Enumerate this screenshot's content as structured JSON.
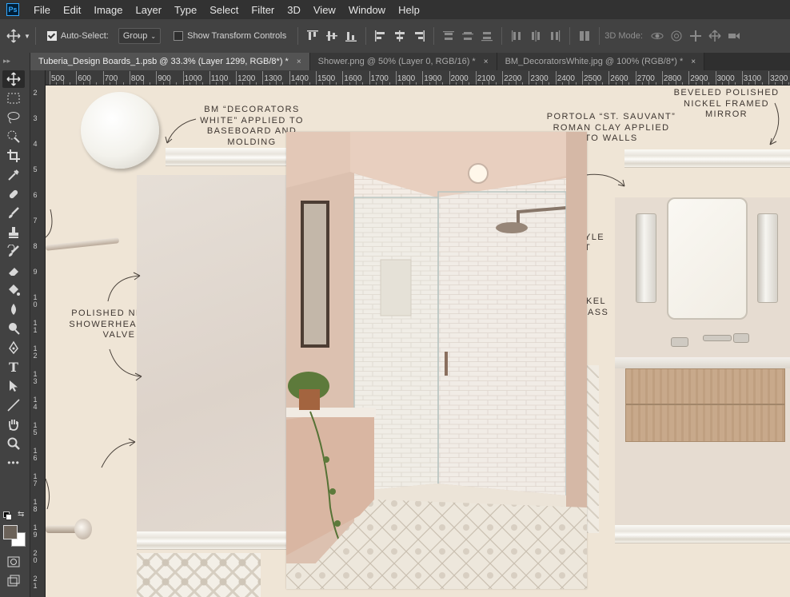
{
  "app": {
    "logo": "Ps"
  },
  "menu": [
    "File",
    "Edit",
    "Image",
    "Layer",
    "Type",
    "Select",
    "Filter",
    "3D",
    "View",
    "Window",
    "Help"
  ],
  "options": {
    "auto_select_label": "Auto-Select:",
    "auto_select_checked": true,
    "auto_select_target": "Group",
    "transform_controls_label": "Show Transform Controls",
    "mode_label": "3D Mode:"
  },
  "tabs": [
    {
      "title": "Tuberia_Design Boards_1.psb @ 33.3% (Layer 1299, RGB/8*) *",
      "active": true,
      "close": "×"
    },
    {
      "title": "Shower.png @ 50% (Layer 0, RGB/16) *",
      "active": false,
      "close": "×"
    },
    {
      "title": "BM_DecoratorsWhite.jpg @ 100% (RGB/8*) *",
      "active": false,
      "close": "×"
    }
  ],
  "ruler_h": [
    "500",
    "600",
    "700",
    "800",
    "900",
    "1000",
    "1100",
    "1200",
    "1300",
    "1400",
    "1500",
    "1600",
    "1700",
    "1800",
    "1900",
    "2000",
    "2100",
    "2200",
    "2300",
    "2400",
    "2500",
    "2600",
    "2700",
    "2800",
    "2900",
    "3000",
    "3100",
    "3200"
  ],
  "ruler_v": [
    "2",
    "3",
    "4",
    "5",
    "6",
    "7",
    "8",
    "9",
    "10",
    "11",
    "12",
    "13",
    "14",
    "15",
    "16",
    "17",
    "18",
    "19",
    "20",
    "21"
  ],
  "tools": [
    "move-tool",
    "marquee-tool",
    "lasso-tool",
    "quick-select-tool",
    "crop-tool",
    "eyedropper-tool",
    "healing-brush-tool",
    "brush-tool",
    "clone-stamp-tool",
    "history-brush-tool",
    "eraser-tool",
    "paint-bucket-tool",
    "blur-tool",
    "dodge-tool",
    "pen-tool",
    "type-tool",
    "path-select-tool",
    "line-tool",
    "hand-tool",
    "zoom-tool",
    "more-tools"
  ],
  "type_tool_glyph": "T",
  "more_tools_glyph": "•••",
  "colors": {
    "foreground": "#6b6259",
    "background": "#ffffff",
    "accent": "#31a8ff"
  },
  "canvas": {
    "notes": {
      "decorators_white": "BM “DECORATORS WHITE” APPLIED TO BASEBOARD AND MOLDING",
      "portola": "PORTOLA “ST. SAUVANT” ROMAN CLAY APPLIED TO WALLS",
      "beveled_mirror": "BEVELED POLISHED NICKEL FRAMED MIRROR",
      "showerhead": "POLISHED NICKEL SHOWERHEAD AND VALVE",
      "partial_style": "YLE",
      "partial_t": "T",
      "partial_nickel": "KEL",
      "partial_glass": "ASS"
    }
  }
}
